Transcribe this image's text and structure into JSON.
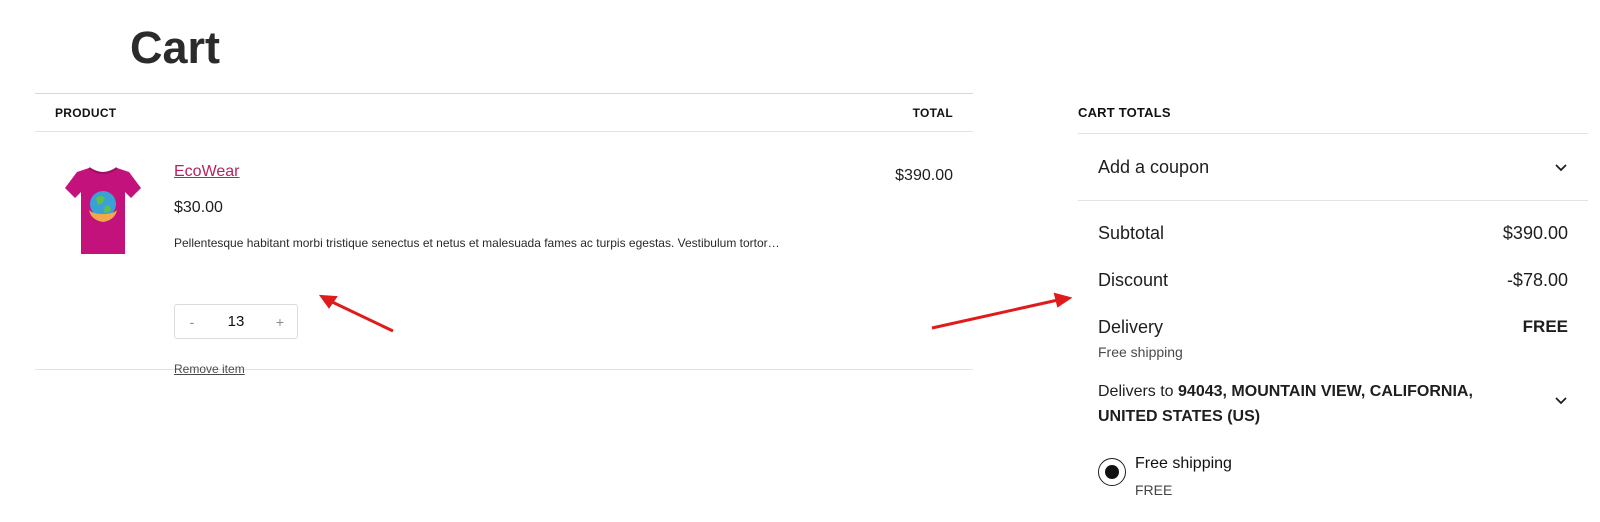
{
  "page": {
    "title": "Cart"
  },
  "cart_table": {
    "headers": {
      "product": "PRODUCT",
      "total": "TOTAL"
    },
    "items": [
      {
        "name": "EcoWear",
        "unit_price": "$30.00",
        "description": "Pellentesque habitant morbi tristique senectus et netus et malesuada fames ac turpis egestas. Vestibulum tortor…",
        "quantity": "13",
        "decrement_label": "-",
        "increment_label": "+",
        "remove_label": "Remove item",
        "line_total": "$390.00",
        "thumbnail_icon": "tshirt-earth-icon"
      }
    ]
  },
  "totals": {
    "heading": "CART TOTALS",
    "coupon_label": "Add a coupon",
    "subtotal_label": "Subtotal",
    "subtotal_value": "$390.00",
    "discount_label": "Discount",
    "discount_value": "-$78.00",
    "delivery_label": "Delivery",
    "delivery_value": "FREE",
    "delivery_method": "Free shipping",
    "delivers_to_prefix": "Delivers to",
    "delivers_to_address": "94043, MOUNTAIN VIEW, CALIFORNIA, UNITED STATES (US)",
    "shipping_option": {
      "name": "Free shipping",
      "price": "FREE",
      "selected": true
    }
  },
  "colors": {
    "link": "#b5245f",
    "shirt": "#c4127c",
    "annotation_arrow": "#e01b1b"
  }
}
